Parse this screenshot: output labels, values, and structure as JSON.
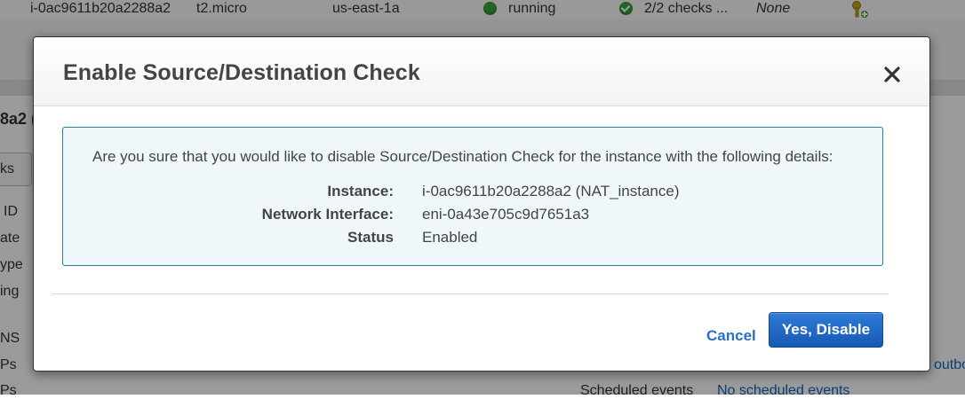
{
  "background": {
    "instance_row": {
      "instance_id": "i-0ac9611b20a2288a2",
      "instance_type": "t2.micro",
      "availability_zone": "us-east-1a",
      "state": "running",
      "status_checks": "2/2 checks ...",
      "alarm_status": "None"
    },
    "left_fragments": {
      "heading": "8a2 (",
      "tab": "ks",
      "row1": "ID",
      "row2": "ate",
      "row3": "ype",
      "row4": "ing",
      "row5": "NS",
      "row6": "Ps",
      "row7": "Ps"
    },
    "lower_right": {
      "partial_label": "Scheduled events",
      "value": "No scheduled events",
      "right_link": "outbo"
    }
  },
  "modal": {
    "title": "Enable Source/Destination Check",
    "confirm_message": "Are you sure that you would like to disable Source/Destination Check for the instance with the following details:",
    "details": [
      {
        "label": "Instance:",
        "value": "i-0ac9611b20a2288a2 (NAT_instance)"
      },
      {
        "label": "Network Interface:",
        "value": "eni-0a43e705c9d7651a3"
      },
      {
        "label": "Status",
        "value": "Enabled"
      }
    ],
    "cancel_label": "Cancel",
    "confirm_label": "Yes, Disable"
  },
  "colors": {
    "primary_button": "#1f66c4",
    "cancel_link": "#2a6fc2",
    "info_border": "#2b7b9b",
    "info_background": "#f0f7fb",
    "running_state": "#3aa33a"
  },
  "icons": {
    "state": "green-circle-icon",
    "checks": "check-circle-icon",
    "alarm": "key-icon",
    "close": "close-icon"
  }
}
